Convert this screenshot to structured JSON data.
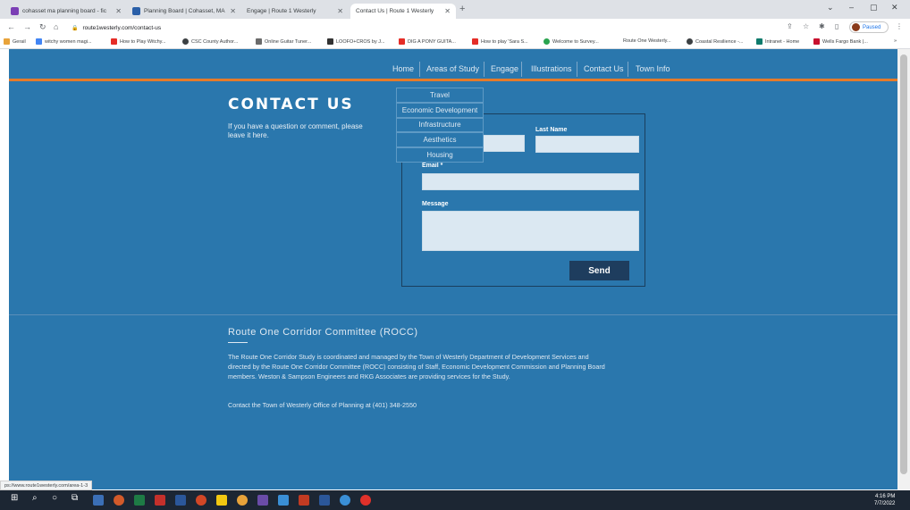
{
  "browser": {
    "tabs": [
      {
        "title": "cohasset ma planning board - fic"
      },
      {
        "title": "Planning Board | Cohasset, MA"
      },
      {
        "title": "Engage | Route 1 Westerly"
      },
      {
        "title": "Contact Us | Route 1 Westerly"
      }
    ],
    "new_tab": "+",
    "window_controls": [
      "⌄",
      "–",
      "▢",
      "✕"
    ],
    "url": "route1westerly.com/contact-us",
    "profile_status": "Paused",
    "bookmarks": [
      "Gerail",
      "witchy women magi...",
      "How to Play Witchy...",
      "CSC County Author...",
      "Online Guitar Tuner...",
      "LOOFO+CROS by J...",
      "DIG A PONY GUITA...",
      "How to play 'Sara S...",
      "Welcome to Survey...",
      "Route One Westerly...",
      "Coastal Resilience -...",
      "Intranet - Home",
      "Wells Fargo Bank |..."
    ]
  },
  "site": {
    "nav": [
      {
        "label": "Home"
      },
      {
        "label": "Areas of Study"
      },
      {
        "label": "Engage"
      },
      {
        "label": "Illustrations"
      },
      {
        "label": "Contact Us"
      },
      {
        "label": "Town Info"
      }
    ],
    "dropdown": [
      "Travel",
      "Economic Development",
      "Infrastructure",
      "Aesthetics",
      "Housing"
    ],
    "contact_title": "CONTACT US",
    "contact_sub": "If you have a question or comment, please leave it here.",
    "form": {
      "last_name_label": "Last Name",
      "email_label": "Email *",
      "message_label": "Message",
      "send_label": "Send"
    },
    "footer": {
      "title": "Route One Corridor Committee (ROCC)",
      "body": "The Route One Corridor Study is coordinated and managed by the Town of Westerly Department of Development Services and directed by the Route One Corridor Committee (ROCC) consisting of Staff, Economic Development Commission and Planning Board members. Weston & Sampson Engineers and RKG Associates are providing services for the Study.",
      "contact": "Contact the Town of Westerly Office of Planning at (401) 348-2550"
    },
    "status_url": "ps://www.route1westerly.com/area-1-3"
  },
  "taskbar": {
    "time": "4:16 PM",
    "date": "7/7/2022"
  }
}
